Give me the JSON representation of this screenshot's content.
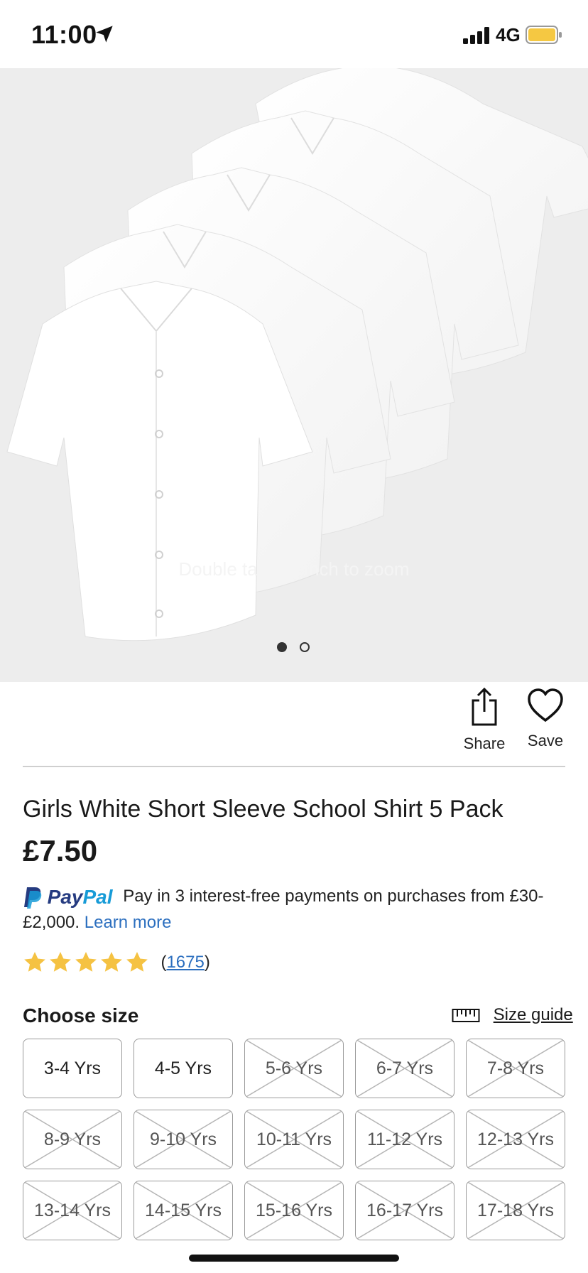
{
  "status_bar": {
    "time": "11:00",
    "network": "4G"
  },
  "gallery": {
    "zoom_hint": "Double tap or pinch to zoom",
    "page_count": 2,
    "active_page": 1
  },
  "actions": {
    "share_label": "Share",
    "save_label": "Save"
  },
  "product": {
    "title": "Girls White Short Sleeve School Shirt 5 Pack",
    "price": "£7.50"
  },
  "paypal": {
    "brand_pay": "Pay",
    "brand_pal": "Pal",
    "message": "Pay in 3 interest-free payments on purchases from £30-£2,000.",
    "learn_more": "Learn more"
  },
  "rating": {
    "stars": 5,
    "count": "1675"
  },
  "sizes": {
    "heading": "Choose size",
    "guide_label": "Size guide",
    "options": [
      {
        "label": "3-4 Yrs",
        "available": true
      },
      {
        "label": "4-5 Yrs",
        "available": true
      },
      {
        "label": "5-6 Yrs",
        "available": false
      },
      {
        "label": "6-7 Yrs",
        "available": false
      },
      {
        "label": "7-8 Yrs",
        "available": false
      },
      {
        "label": "8-9 Yrs",
        "available": false
      },
      {
        "label": "9-10 Yrs",
        "available": false
      },
      {
        "label": "10-11 Yrs",
        "available": false
      },
      {
        "label": "11-12 Yrs",
        "available": false
      },
      {
        "label": "12-13 Yrs",
        "available": false
      },
      {
        "label": "13-14 Yrs",
        "available": false
      },
      {
        "label": "14-15 Yrs",
        "available": false
      },
      {
        "label": "15-16 Yrs",
        "available": false
      },
      {
        "label": "16-17 Yrs",
        "available": false
      },
      {
        "label": "17-18 Yrs",
        "available": false
      }
    ]
  },
  "colors": {
    "accent_link": "#2c6fbf",
    "paypal_dark": "#253b80",
    "paypal_light": "#179bd7",
    "star": "#f5c242",
    "battery": "#f5c842"
  }
}
